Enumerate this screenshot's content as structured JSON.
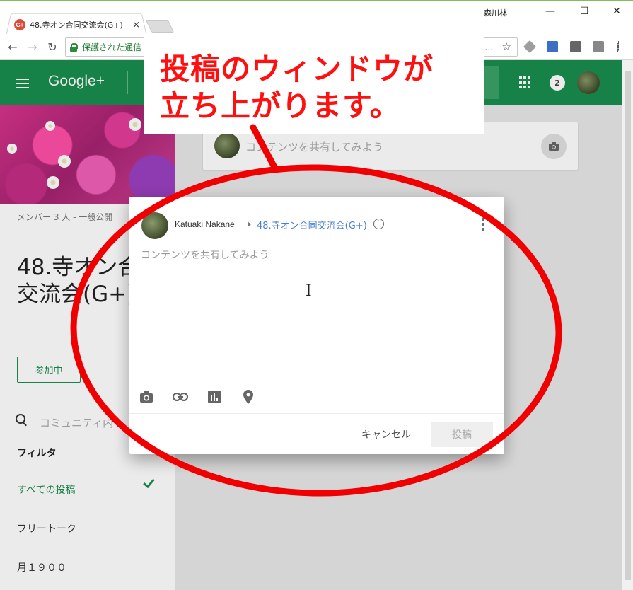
{
  "browser": {
    "tab_title": "48.寺オン合同交流会(G+)",
    "tab_close": "×",
    "favicon_text": "G+",
    "user_name": "森川林",
    "window_controls": {
      "minimize": "—",
      "maximize": "☐",
      "close": "✕"
    },
    "nav": {
      "back": "←",
      "forward": "→",
      "reload": "↻"
    },
    "address_secure_label": "保護された通信",
    "address_tail": "l...",
    "star": "☆"
  },
  "header": {
    "logo": "Google+",
    "notification_count": "2"
  },
  "community": {
    "member_info": "メンバー 3 人 - 一般公開",
    "title": "48.寺オン合同交流会(G+)",
    "join_button": "参加中",
    "search_placeholder": "コミュニティ内",
    "filter_label": "フィルタ",
    "filters": [
      {
        "label": "すべての投稿",
        "active": true
      },
      {
        "label": "フリートーク",
        "active": false
      },
      {
        "label": "月１９００",
        "active": false
      }
    ]
  },
  "stream": {
    "share_prompt": "コンテンツを共有してみよう"
  },
  "dialog": {
    "author": "Katuaki Nakane",
    "community": "48.寺オン合同交流会(G+)",
    "placeholder": "コンテンツを共有してみよう",
    "cancel_label": "キャンセル",
    "post_label": "投稿",
    "attachments": [
      "camera-icon",
      "link-icon",
      "poll-icon",
      "location-icon"
    ]
  },
  "annotation": {
    "text_line1": "投稿のウィンドウが",
    "text_line2": "立ち上がります。",
    "color": "#ff1010"
  },
  "colors": {
    "brand_green": "#1a8e4f",
    "link_blue": "#4a7fd4"
  }
}
